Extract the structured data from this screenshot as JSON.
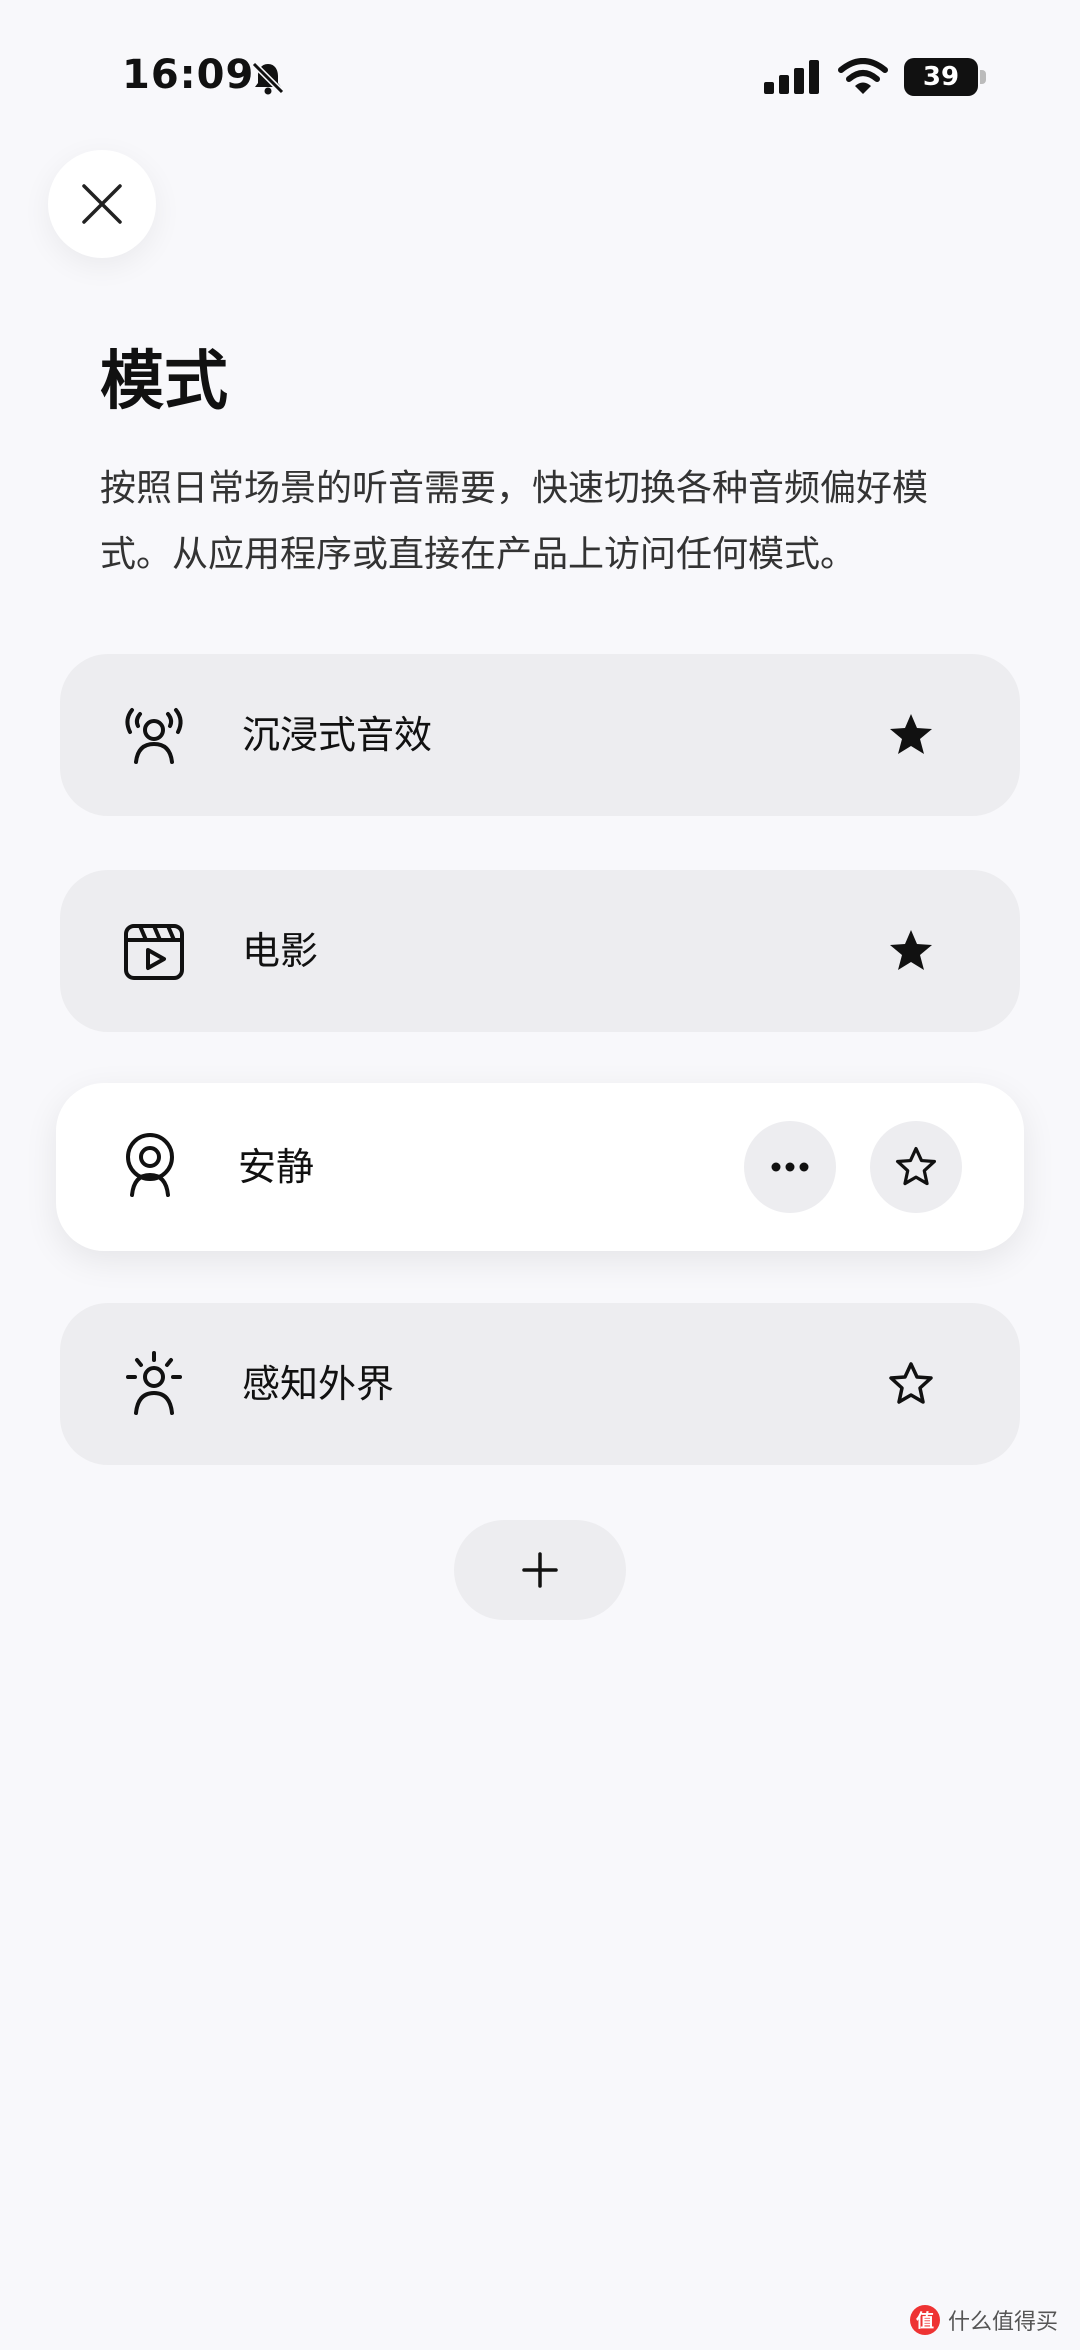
{
  "status_bar": {
    "time": "16:09",
    "battery": "39",
    "icons": [
      "bell-slash-icon",
      "signal-icon",
      "wifi-icon",
      "battery-icon"
    ]
  },
  "close_button": {
    "icon": "close-icon"
  },
  "title": "模式",
  "description": "按照日常场景的听音需要，快速切换各种音频偏好模式。从应用程序或直接在产品上访问任何模式。",
  "modes": [
    {
      "label": "沉浸式音效",
      "icon": "immersive-audio-icon",
      "favorite": true,
      "active": false
    },
    {
      "label": "电影",
      "icon": "movie-clapper-icon",
      "favorite": true,
      "active": false
    },
    {
      "label": "安静",
      "icon": "quiet-mode-icon",
      "favorite": false,
      "active": true,
      "more_icon": "more-horizontal-icon"
    },
    {
      "label": "感知外界",
      "icon": "aware-mode-icon",
      "favorite": false,
      "active": false
    }
  ],
  "add_button": {
    "icon": "plus-icon"
  },
  "watermark": {
    "text": "什么值得买",
    "logo_text": "值"
  },
  "colors": {
    "background": "#f8f8fb",
    "card": "#ededf0",
    "card_active": "#ffffff",
    "text": "#111111"
  }
}
